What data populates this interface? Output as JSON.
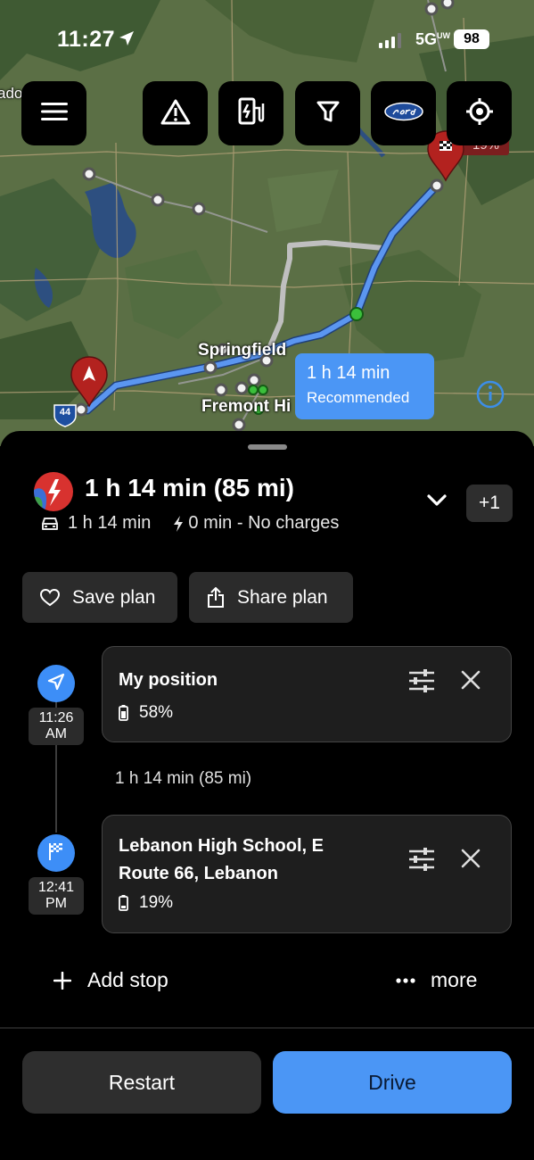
{
  "status_bar": {
    "time": "11:27",
    "network": "5G",
    "network_suffix": "UW",
    "battery": "98"
  },
  "map": {
    "edge_label": "ado",
    "city_label_1": "Springfield",
    "city_label_2": "Fremont Hi",
    "highway_shield": "44",
    "destination_flag_text": "19%",
    "route_callout": {
      "duration": "1 h 14 min",
      "tag": "Recommended"
    },
    "toolbar": [
      "menu-icon",
      "warning-icon",
      "charger-icon",
      "filter-icon",
      "ford-icon",
      "locate-icon"
    ]
  },
  "trip": {
    "title": "1 h 14 min (85 mi)",
    "drive_time": "1 h 14 min",
    "charge_summary": "0 min - No charges",
    "alternatives_badge": "+1"
  },
  "actions": {
    "save_plan": "Save plan",
    "share_plan": "Share plan"
  },
  "stops": [
    {
      "time_line1": "11:26",
      "time_line2": "AM",
      "name": "My position",
      "battery": "58%"
    },
    {
      "time_line1": "12:41",
      "time_line2": "PM",
      "name_line1": "Lebanon High School, E",
      "name_line2": "Route 66, Lebanon",
      "battery": "19%"
    }
  ],
  "leg_summary": "1 h 14 min (85 mi)",
  "add_stop": "Add stop",
  "more": "more",
  "footer": {
    "restart": "Restart",
    "drive": "Drive"
  },
  "colors": {
    "accent": "#4b96f5",
    "route": "#5b96f0",
    "alt_route": "#c8c8c8",
    "pin": "#b3221f"
  }
}
